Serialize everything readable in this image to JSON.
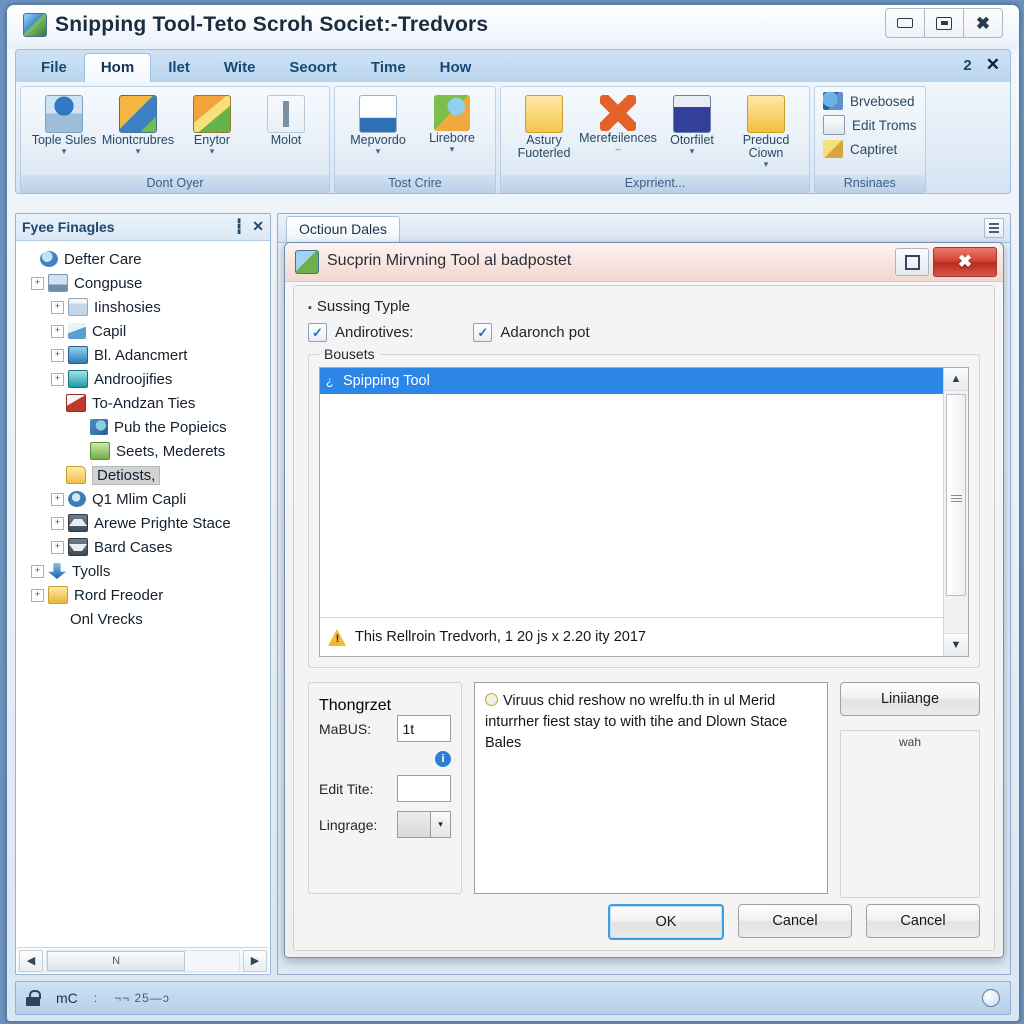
{
  "window": {
    "title": "Snipping Tool-Teto Scroh Societ:-Tredvors",
    "icon": "app-icon",
    "controls": {
      "minimize": "minimize-icon",
      "maximize": "maximize-icon",
      "close": "close-icon"
    }
  },
  "ribbon": {
    "tabs": [
      {
        "label": "File",
        "active": false
      },
      {
        "label": "Hom",
        "active": true
      },
      {
        "label": "Ilet",
        "active": false
      },
      {
        "label": "Wite",
        "active": false
      },
      {
        "label": "Seoort",
        "active": false
      },
      {
        "label": "Time",
        "active": false
      },
      {
        "label": "How",
        "active": false
      }
    ],
    "right": {
      "badge": "2",
      "close": "✕"
    },
    "groups": [
      {
        "label": "Dont Oyer",
        "items": [
          {
            "label": "Tople Sules",
            "dropdown": "▾",
            "icon": "new-snip-icon"
          },
          {
            "label": "Miontcrubres",
            "dropdown": "▾",
            "icon": "mode-icon"
          },
          {
            "label": "Enytor",
            "dropdown": "▾",
            "icon": "editor-icon"
          },
          {
            "label": "Molot",
            "dropdown": "",
            "icon": "pin-icon"
          }
        ]
      },
      {
        "label": "Tost Crire",
        "items": [
          {
            "label": "Mepvordo",
            "dropdown": "▾",
            "icon": "document-icon"
          },
          {
            "label": "Lirebore",
            "dropdown": "▾",
            "icon": "globe-icon"
          }
        ]
      },
      {
        "label": "Exprrient...",
        "items": [
          {
            "label": "Astury Fuoterled",
            "dropdown": "",
            "icon": "folder-icon"
          },
          {
            "label": "Merefeilences",
            "dropdown": "–",
            "icon": "preferences-icon"
          },
          {
            "label": "Otorfilet",
            "dropdown": "▾",
            "icon": "window-icon"
          },
          {
            "label": "Preducd Ciown",
            "dropdown": "▾",
            "icon": "folder-down-icon"
          }
        ]
      }
    ],
    "stacked_group": {
      "label": "Rnsinaes",
      "items": [
        {
          "label": "Brvebosed",
          "icon": "browse-icon"
        },
        {
          "label": "Edit Troms",
          "icon": "edit-icon"
        },
        {
          "label": "Captiret",
          "icon": "capture-icon"
        }
      ]
    }
  },
  "tree_panel": {
    "title": "Fyee Finagles",
    "buttons": {
      "pin": "┇",
      "close": "✕"
    },
    "items": [
      {
        "label": "Defter Care",
        "indent": 0,
        "expander": "",
        "icon": "globe-icon"
      },
      {
        "label": "Congpuse",
        "indent": 1,
        "expander": "+",
        "icon": "computer-icon"
      },
      {
        "label": "Iinshosies",
        "indent": 2,
        "expander": "+",
        "icon": "window-icon"
      },
      {
        "label": "Capil",
        "indent": 2,
        "expander": "+",
        "icon": "capil-icon"
      },
      {
        "label": "Bl. Adancmert",
        "indent": 2,
        "expander": "+",
        "icon": "blue-drive-icon"
      },
      {
        "label": "Androojifies",
        "indent": 2,
        "expander": "+",
        "icon": "teal-drive-icon"
      },
      {
        "label": "To-Andzan Ties",
        "indent": 2,
        "expander": "",
        "icon": "red-book-icon"
      },
      {
        "label": "Pub the Popieics",
        "indent": 3,
        "expander": "",
        "icon": "pub-icon"
      },
      {
        "label": "Seets, Mederets",
        "indent": 3,
        "expander": "",
        "icon": "sheets-icon"
      },
      {
        "label": "Detiosts,",
        "indent": 2,
        "expander": "",
        "icon": "folder-icon",
        "selected": true
      },
      {
        "label": "Q1 Mlim Capli",
        "indent": 2,
        "expander": "+",
        "icon": "q1-icon"
      },
      {
        "label": "Arewe Prighte Stace",
        "indent": 2,
        "expander": "+",
        "icon": "up-arrow-icon"
      },
      {
        "label": "Bard Cases",
        "indent": 2,
        "expander": "+",
        "icon": "down-arrow-icon"
      },
      {
        "label": "Tyolls",
        "indent": 1,
        "expander": "+",
        "icon": "download-icon"
      },
      {
        "label": "Rord Freoder",
        "indent": 1,
        "expander": "+",
        "icon": "folder-icon"
      },
      {
        "label": "Onl Vrecks",
        "indent": 1,
        "expander": "",
        "icon": "none"
      }
    ],
    "hscroll": {
      "left": "◀",
      "right": "▶",
      "thumb_label": "N"
    }
  },
  "document": {
    "tab": "Octioun Dales",
    "menu_icon": "hamburger-icon"
  },
  "dialog": {
    "title": "Sucprin Mirvning Tool al badpostet",
    "icon": "dialog-app-icon",
    "restore": "restore-icon",
    "close": "✖",
    "section_title": "Sussing Typle",
    "checkboxes": [
      {
        "label": "Andirotives:",
        "checked": true
      },
      {
        "label": "Adaronch pot",
        "checked": true
      }
    ],
    "list_group_label": "Bousets",
    "list_items": [
      {
        "label": "Spipping Tool",
        "icon": "¿",
        "selected": true
      }
    ],
    "warning": {
      "icon": "warning-icon",
      "text": "This Rellroin Tredvorh, 1 20 js x 2.20 ity 2017"
    },
    "scrollbar": {
      "up": "▲",
      "down": "▼"
    },
    "form_group": {
      "legend": "Thongrzet",
      "fields": [
        {
          "label": "MaBUS:",
          "value": "1t",
          "type": "text"
        },
        {
          "label": "Edit Tite:",
          "value": "",
          "type": "text"
        },
        {
          "label": "Lingrage:",
          "value": "",
          "type": "combo",
          "arrow": "▾"
        }
      ],
      "info_badge": "i"
    },
    "info_text": "Viruus chid reshow no wrelfu.th in ul Merid inturrher fiest stay to with tihe and Dlown Stace Bales",
    "side": {
      "button": "Liniiange",
      "preview_label": "wah"
    },
    "footer_buttons": [
      {
        "label": "OK",
        "default": true
      },
      {
        "label": "Cancel",
        "default": false
      },
      {
        "label": "Cancel",
        "default": false
      }
    ]
  },
  "statusbar": {
    "lock_icon": "lock-icon",
    "text": "mC",
    "separator": ":",
    "dim_text": "¬¬ 25—ɔ",
    "right_icon": "status-circle-icon"
  }
}
